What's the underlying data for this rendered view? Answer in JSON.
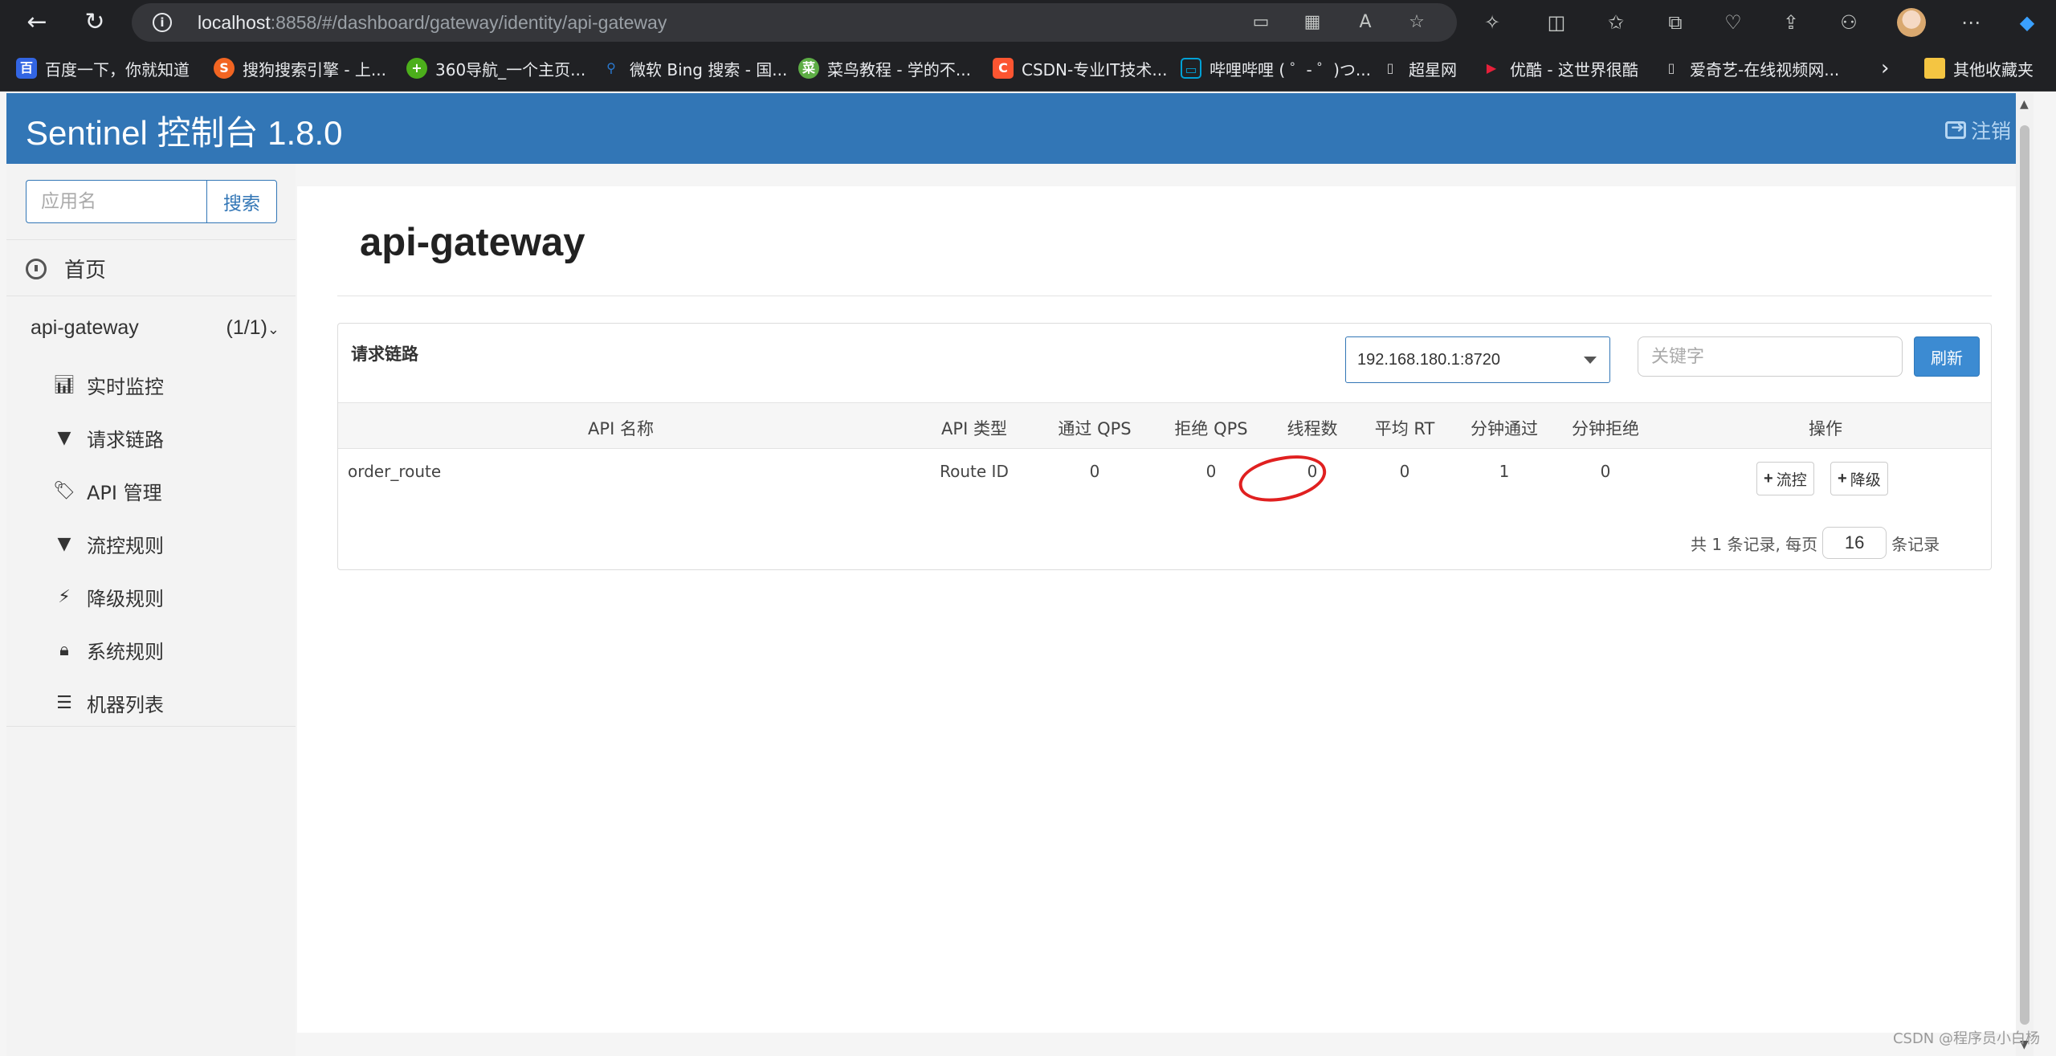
{
  "browser": {
    "url_host": "localhost",
    "url_rest": ":8858/#/dashboard/gateway/identity/api-gateway",
    "bookmarks": [
      {
        "label": "百度一下，你就知道",
        "color": "#3265e3"
      },
      {
        "label": "搜狗搜索引擎 - 上...",
        "color": "#f26522"
      },
      {
        "label": "360导航_一个主页...",
        "color": "#4caf1b"
      },
      {
        "label": "微软 Bing 搜索 - 国...",
        "color": "#2a7ad2"
      },
      {
        "label": "菜鸟教程 - 学的不...",
        "color": "#5dad45"
      },
      {
        "label": "CSDN-专业IT技术...",
        "color": "#fc5531"
      },
      {
        "label": "哔哩哔哩 ( ゜- ゜)つ...",
        "color": "#00a1d6"
      },
      {
        "label": "超星网",
        "color": "#888888"
      },
      {
        "label": "优酷 - 这世界很酷",
        "color": "#e6203a"
      },
      {
        "label": "爱奇艺-在线视频网...",
        "color": "#888888"
      },
      {
        "label": "其他收藏夹",
        "color": "#f4c542"
      }
    ]
  },
  "app": {
    "title": "Sentinel 控制台 1.8.0",
    "logout_label": "注销"
  },
  "sidebar": {
    "search_placeholder": "应用名",
    "search_button": "搜索",
    "home_label": "首页",
    "app_name": "api-gateway",
    "app_count": "(1/1)",
    "items": [
      {
        "label": "实时监控",
        "icon": "bar-chart-icon"
      },
      {
        "label": "请求链路",
        "icon": "filter-icon"
      },
      {
        "label": "API 管理",
        "icon": "tags-icon"
      },
      {
        "label": "流控规则",
        "icon": "filter-icon"
      },
      {
        "label": "降级规则",
        "icon": "flash-icon"
      },
      {
        "label": "系统规则",
        "icon": "lock-icon"
      },
      {
        "label": "机器列表",
        "icon": "list-icon"
      }
    ]
  },
  "main": {
    "heading": "api-gateway",
    "panel_title": "请求链路",
    "machine_selected": "192.168.180.1:8720",
    "keyword_placeholder": "关键字",
    "refresh_button": "刷新",
    "columns": [
      "API 名称",
      "API 类型",
      "通过 QPS",
      "拒绝 QPS",
      "线程数",
      "平均 RT",
      "分钟通过",
      "分钟拒绝",
      "操作"
    ],
    "rows": [
      {
        "name": "order_route",
        "type": "Route ID",
        "pass_qps": "0",
        "block_qps": "0",
        "threads": "0",
        "avg_rt": "0",
        "minute_pass": "1",
        "minute_block": "0",
        "flow_button": "流控",
        "degrade_button": "降级"
      }
    ],
    "pager_prefix": "共 1 条记录, 每页",
    "page_size": "16",
    "pager_suffix": "条记录"
  },
  "watermark": "CSDN @程序员小白杨"
}
